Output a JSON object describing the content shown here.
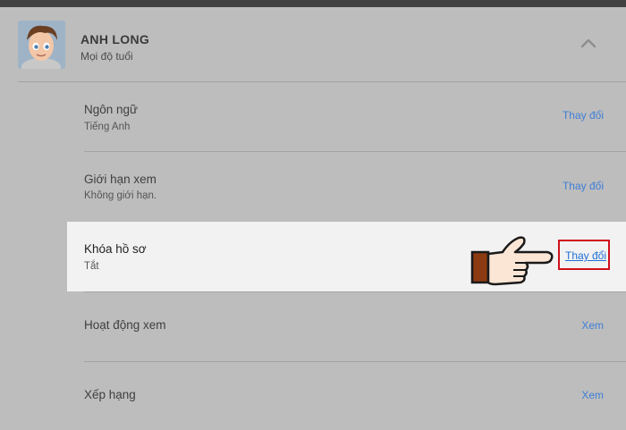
{
  "profile": {
    "name": "ANH LONG",
    "rating": "Mọi độ tuổi"
  },
  "settings": [
    {
      "title": "Ngôn ngữ",
      "value": "Tiếng Anh",
      "action": "Thay đổi"
    },
    {
      "title": "Giới hạn xem",
      "value": "Không giới hạn.",
      "action": "Thay đổi"
    },
    {
      "title": "Khóa hồ sơ",
      "value": "Tắt",
      "action": "Thay đổi"
    },
    {
      "title": "Hoạt động xem",
      "value": "",
      "action": "Xem"
    },
    {
      "title": "Xếp hạng",
      "value": "",
      "action": "Xem"
    }
  ],
  "colors": {
    "overlay_bg": "#bdbdbd",
    "highlight_bg": "#f2f2f2",
    "link": "#3f7ed6",
    "callout_border": "#d0101a",
    "hand_cuff": "#8b3a12"
  },
  "icons": {
    "collapse": "chevron-up-icon",
    "pointer": "pointing-hand-icon"
  }
}
